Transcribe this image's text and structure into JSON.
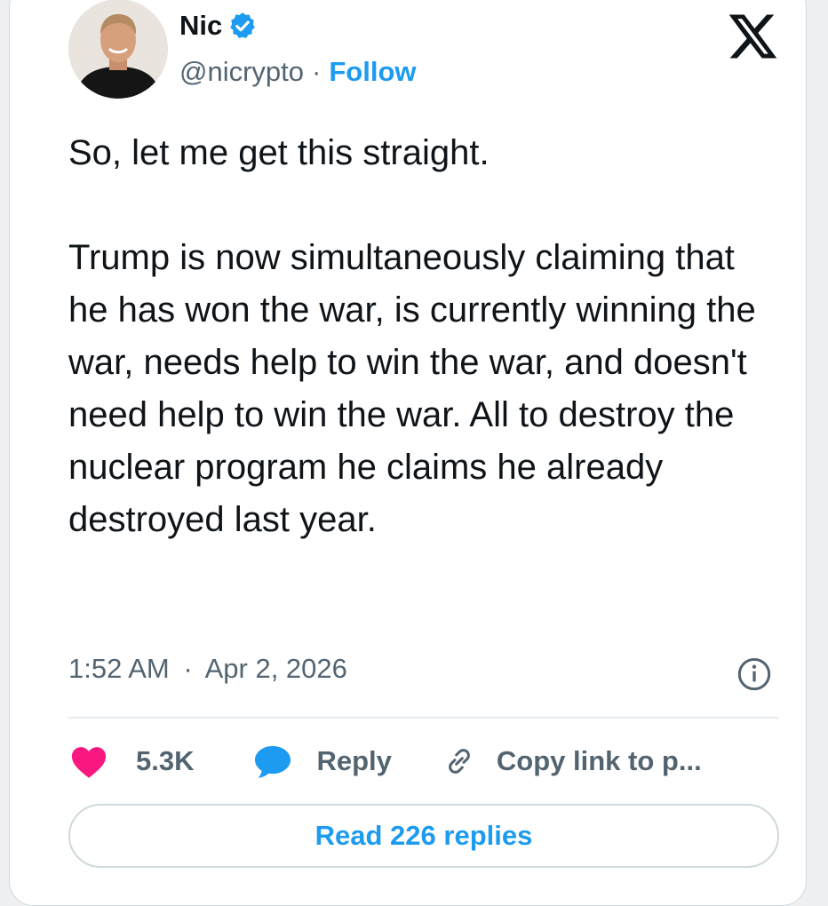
{
  "author": {
    "name": "Nic",
    "handle": "@nicrypto",
    "separator": "·",
    "follow_label": "Follow",
    "avatar": "profile-photo"
  },
  "brand": {
    "logo": "x-logo-icon",
    "color": "#0f1419"
  },
  "tweet": {
    "text": "So, let me get this straight.\n\nTrump is now simultaneously claiming that he has won the war, is currently winning the war, needs help to win the war, and doesn't need help to win the war. All to destroy the nuclear program he claims he already destroyed last year.",
    "time": "1:52 AM",
    "date": "Apr 2, 2026",
    "time_separator": "·"
  },
  "actions": {
    "likes_count": "5.3K",
    "reply_label": "Reply",
    "copy_link_label": "Copy link to p..."
  },
  "footer": {
    "read_replies_label": "Read 226 replies"
  },
  "colors": {
    "accent": "#1d9bf0",
    "heart": "#f91880",
    "secondary_text": "#536471",
    "border": "#cfd9de"
  }
}
